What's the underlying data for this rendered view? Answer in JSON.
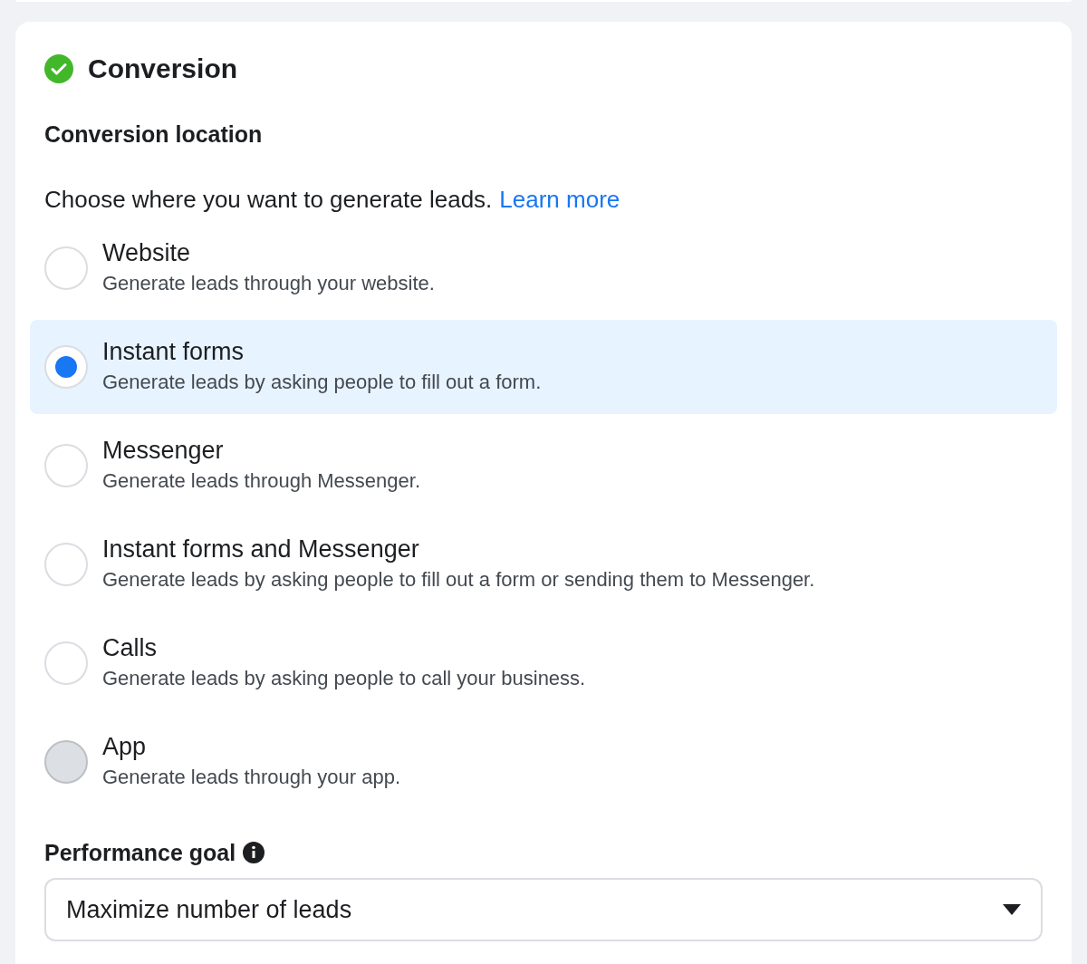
{
  "section": {
    "title": "Conversion",
    "complete": true
  },
  "conversion_location": {
    "heading": "Conversion location",
    "description": "Choose where you want to generate leads.",
    "link": "Learn more"
  },
  "options": [
    {
      "label": "Website",
      "description": "Generate leads through your website.",
      "selected": false,
      "disabled": false
    },
    {
      "label": "Instant forms",
      "description": "Generate leads by asking people to fill out a form.",
      "selected": true,
      "disabled": false
    },
    {
      "label": "Messenger",
      "description": "Generate leads through Messenger.",
      "selected": false,
      "disabled": false
    },
    {
      "label": "Instant forms and Messenger",
      "description": "Generate leads by asking people to fill out a form or sending them to Messenger.",
      "selected": false,
      "disabled": false
    },
    {
      "label": "Calls",
      "description": "Generate leads by asking people to call your business.",
      "selected": false,
      "disabled": false
    },
    {
      "label": "App",
      "description": "Generate leads through your app.",
      "selected": false,
      "disabled": true
    }
  ],
  "performance_goal": {
    "label": "Performance goal",
    "value": "Maximize number of leads"
  }
}
